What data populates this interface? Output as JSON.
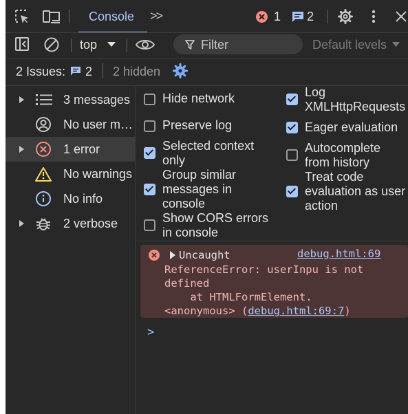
{
  "tabbar": {
    "active_tab": "Console",
    "more_tabs": ">>",
    "error_count": "1",
    "message_count": "2"
  },
  "toolbar": {
    "context": "top",
    "filter_placeholder": "Filter",
    "levels": "Default levels"
  },
  "issues": {
    "label": "2 Issues:",
    "count": "2",
    "hidden": "2 hidden"
  },
  "sidebar": {
    "items": [
      {
        "label": "3 messages",
        "icon": "list-icon",
        "expandable": true,
        "selected": false
      },
      {
        "label": "No user m…",
        "icon": "user-icon",
        "expandable": false,
        "selected": false
      },
      {
        "label": "1 error",
        "icon": "error-icon",
        "expandable": true,
        "selected": true
      },
      {
        "label": "No warnings",
        "icon": "warning-icon",
        "expandable": false,
        "selected": false
      },
      {
        "label": "No info",
        "icon": "info-icon",
        "expandable": false,
        "selected": false
      },
      {
        "label": "2 verbose",
        "icon": "bug-icon",
        "expandable": true,
        "selected": false
      }
    ]
  },
  "settings": {
    "left": [
      {
        "lines": [
          "Hide network"
        ],
        "checked": false
      },
      {
        "lines": [
          "Preserve log"
        ],
        "checked": false
      },
      {
        "lines": [
          "Selected context",
          "only"
        ],
        "checked": true
      },
      {
        "lines": [
          "Group similar",
          "messages in",
          "console"
        ],
        "checked": true
      },
      {
        "lines": [
          "Show CORS errors",
          "in console"
        ],
        "checked": false
      }
    ],
    "right": [
      {
        "lines": [
          "Log",
          "XMLHttpRequests"
        ],
        "checked": true
      },
      {
        "lines": [
          "Eager evaluation"
        ],
        "checked": true
      },
      {
        "lines": [
          "Autocomplete",
          "from history"
        ],
        "checked": false
      },
      {
        "lines": [
          "Treat code",
          "evaluation as user",
          "action"
        ],
        "checked": true
      }
    ]
  },
  "console_error": {
    "prefix": "Uncaught",
    "source": "debug.html:69",
    "line2": "ReferenceError: userInpu is not",
    "line3": "defined",
    "line4": "    at HTMLFormElement.",
    "line5_prefix": "<anonymous> (",
    "line5_link": "debug.html:69:7",
    "line5_suffix": ")"
  },
  "prompt": ">",
  "colors": {
    "panel_bg": "#282828",
    "accent": "#a8c7fa",
    "error": "#f28b82",
    "error_bg": "#4e3535",
    "warning": "#fdd663"
  }
}
